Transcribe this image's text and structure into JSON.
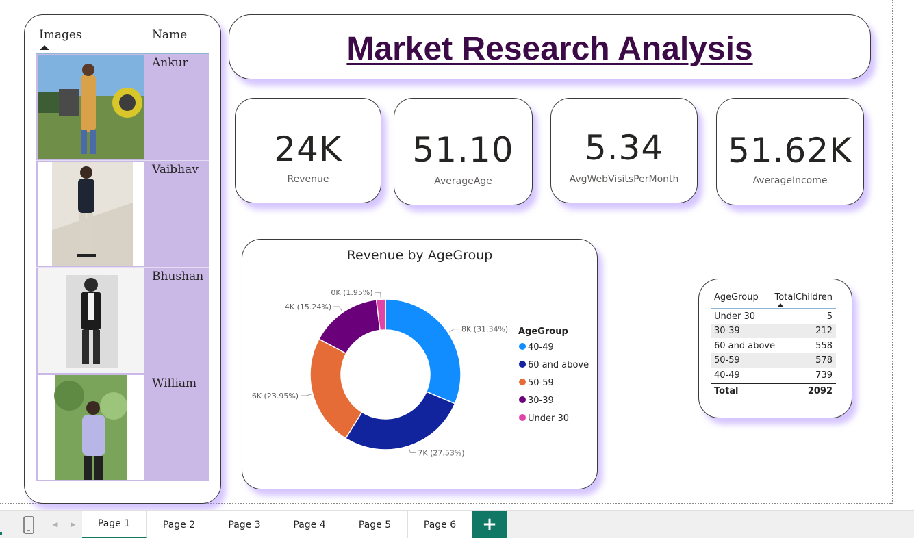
{
  "title": "Market Research Analysis",
  "people_table": {
    "headers": {
      "images": "Images",
      "name": "Name"
    },
    "rows": [
      {
        "name": "Ankur"
      },
      {
        "name": "Vaibhav"
      },
      {
        "name": "Bhushan"
      },
      {
        "name": "William"
      }
    ]
  },
  "kpis": [
    {
      "value": "24K",
      "label": "Revenue"
    },
    {
      "value": "51.10",
      "label": "AverageAge"
    },
    {
      "value": "5.34",
      "label": "AvgWebVisitsPerMonth"
    },
    {
      "value": "51.62K",
      "label": "AverageIncome"
    }
  ],
  "chart_data": {
    "type": "pie",
    "title": "Revenue by AgeGroup",
    "legend_title": "AgeGroup",
    "legend_position": "right",
    "categories": [
      "40-49",
      "60 and above",
      "50-59",
      "30-39",
      "Under 30"
    ],
    "values": [
      31.34,
      27.53,
      23.95,
      15.24,
      1.95
    ],
    "data_labels": [
      "8K (31.34%)",
      "7K (27.53%)",
      "6K (23.95%)",
      "4K (15.24%)",
      "0K (1.95%)"
    ],
    "colors": [
      "#118dff",
      "#12239e",
      "#e66c37",
      "#6b007b",
      "#e044a7"
    ]
  },
  "age_table": {
    "headers": {
      "group": "AgeGroup",
      "children": "TotalChildren"
    },
    "rows": [
      {
        "group": "Under 30",
        "children": "5"
      },
      {
        "group": "30-39",
        "children": "212"
      },
      {
        "group": "60 and above",
        "children": "558"
      },
      {
        "group": "50-59",
        "children": "578"
      },
      {
        "group": "40-49",
        "children": "739"
      }
    ],
    "total_label": "Total",
    "total_value": "2092"
  },
  "page_tabs": {
    "pages": [
      "Page 1",
      "Page 2",
      "Page 3",
      "Page 4",
      "Page 5",
      "Page 6"
    ],
    "active": "Page 1",
    "add_label": "+"
  },
  "colors": {
    "accent_purple": "#cab9e6",
    "title_color": "#3c0a47",
    "tab_accent": "#117865"
  }
}
